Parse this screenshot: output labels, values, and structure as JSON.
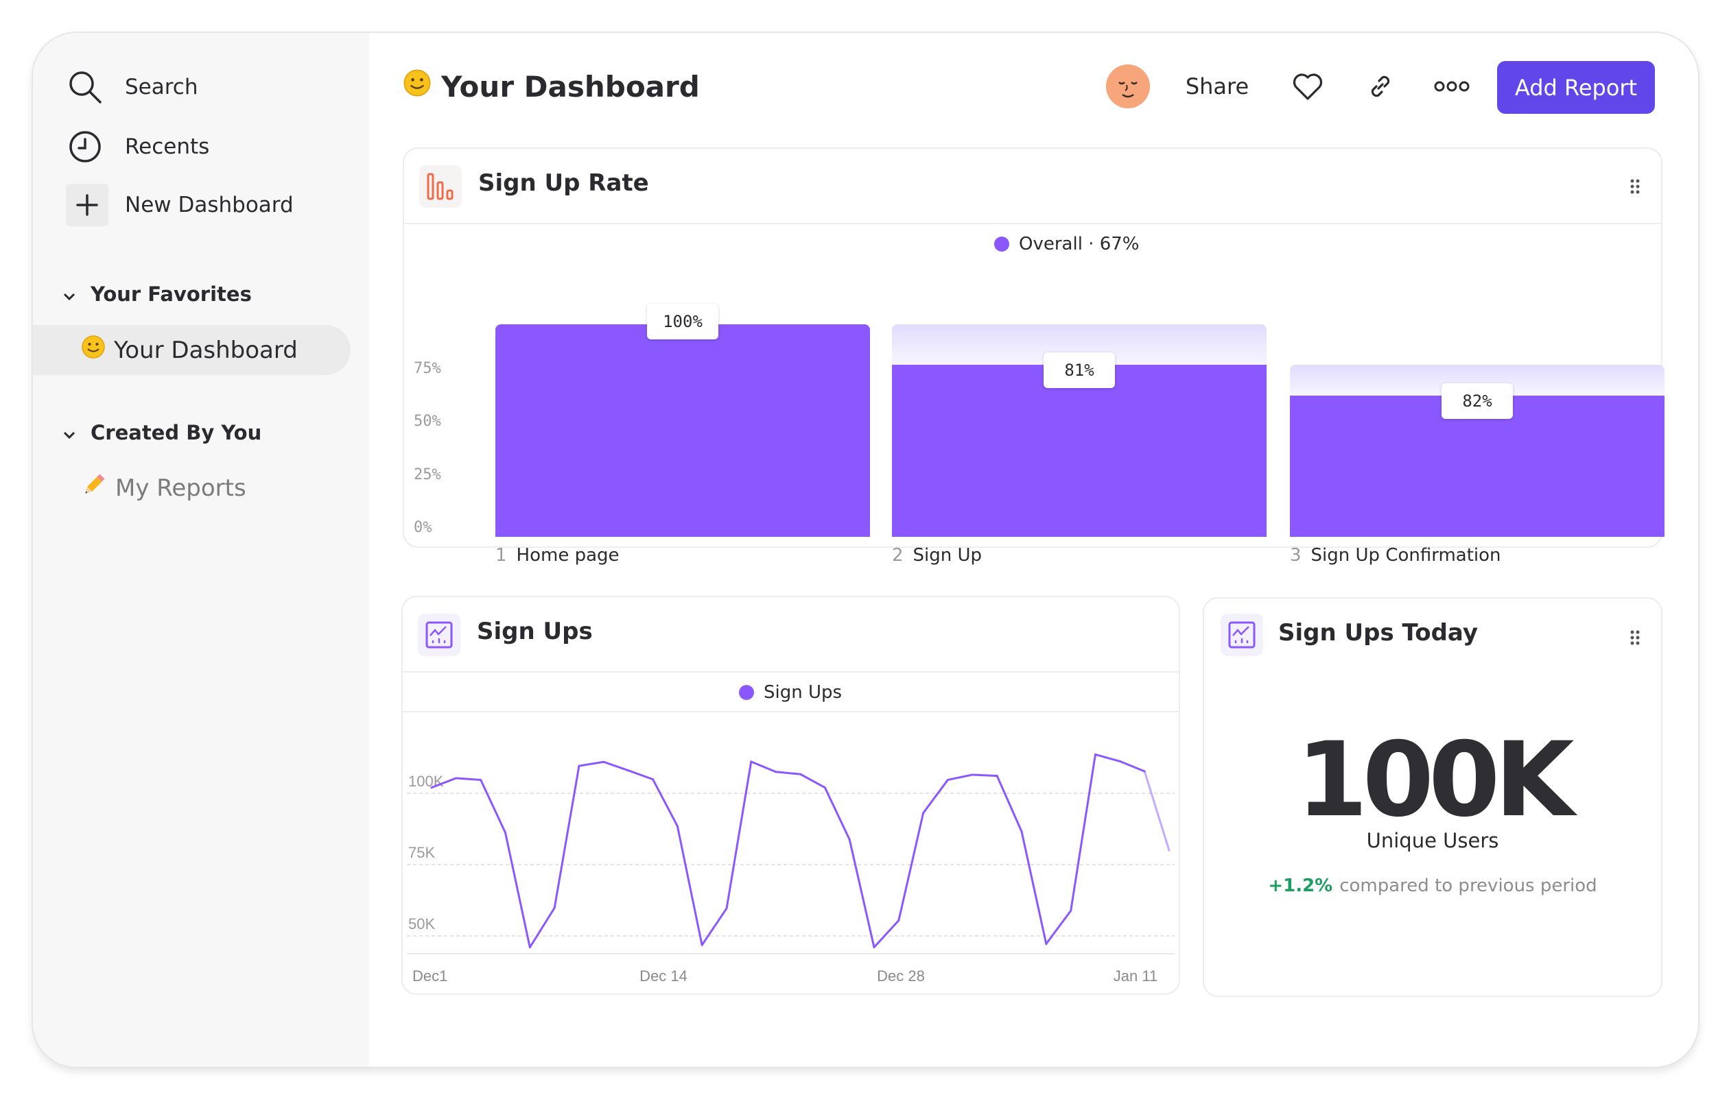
{
  "sidebar": {
    "nav": [
      {
        "label": "Search",
        "icon": "search-icon"
      },
      {
        "label": "Recents",
        "icon": "clock-icon"
      },
      {
        "label": "New Dashboard",
        "icon": "plus-icon"
      }
    ],
    "sections": [
      {
        "label": "Your Favorites",
        "items": [
          {
            "label": "Your Dashboard",
            "icon": "smiley-icon",
            "active": true
          }
        ]
      },
      {
        "label": "Created By You",
        "items": [
          {
            "label": "My Reports",
            "icon": "pencil-icon"
          }
        ]
      }
    ]
  },
  "header": {
    "title": "Your Dashboard",
    "share_label": "Share",
    "add_report_label": "Add Report",
    "accent": "#6147ea"
  },
  "cards": {
    "signup_rate": {
      "title": "Sign Up Rate",
      "legend": "Overall",
      "legend_value": "67%"
    },
    "signups": {
      "title": "Sign Ups"
    },
    "signups_today": {
      "title": "Sign Ups Today",
      "value": "100K",
      "label": "Unique Users",
      "change": "+1.2%",
      "change_text": "compared to previous period",
      "change_color": "#1f9d62"
    }
  },
  "chart_data": [
    {
      "type": "bar",
      "title": "Sign Up Rate",
      "categories": [
        "Home page",
        "Sign Up",
        "Sign Up Confirmation"
      ],
      "step_numbers": [
        "1",
        "2",
        "3"
      ],
      "conversion_labels": [
        "100%",
        "81%",
        "82%"
      ],
      "conversion": [
        100,
        81,
        82
      ],
      "overall": 67,
      "legend": "Overall",
      "y_ticks": [
        "0%",
        "25%",
        "50%",
        "75%"
      ],
      "ylim": [
        0,
        100
      ],
      "color": "#8b57ff",
      "dropoff_color": "#e1dbff"
    },
    {
      "type": "line",
      "title": "Sign Ups",
      "series": [
        {
          "name": "Sign Ups",
          "values": [
            102,
            105.3,
            104.7,
            86.2,
            46,
            59.8,
            109.6,
            111,
            108,
            104.9,
            88.5,
            46.8,
            59.6,
            111.1,
            107.5,
            106.7,
            102,
            83.8,
            46,
            55.4,
            93.1,
            104.7,
            106.5,
            106.1,
            86.6,
            47.2,
            58.8,
            113.6,
            111.2,
            107.7,
            80
          ]
        }
      ],
      "value_unit": "K",
      "y_ticks": [
        "50K",
        "75K",
        "100K"
      ],
      "x_ticks": [
        "Dec1",
        "Dec 14",
        "Dec 28",
        "Jan 11"
      ],
      "ylim": [
        25,
        117
      ],
      "color": "#8b57ff",
      "grid": true
    }
  ]
}
